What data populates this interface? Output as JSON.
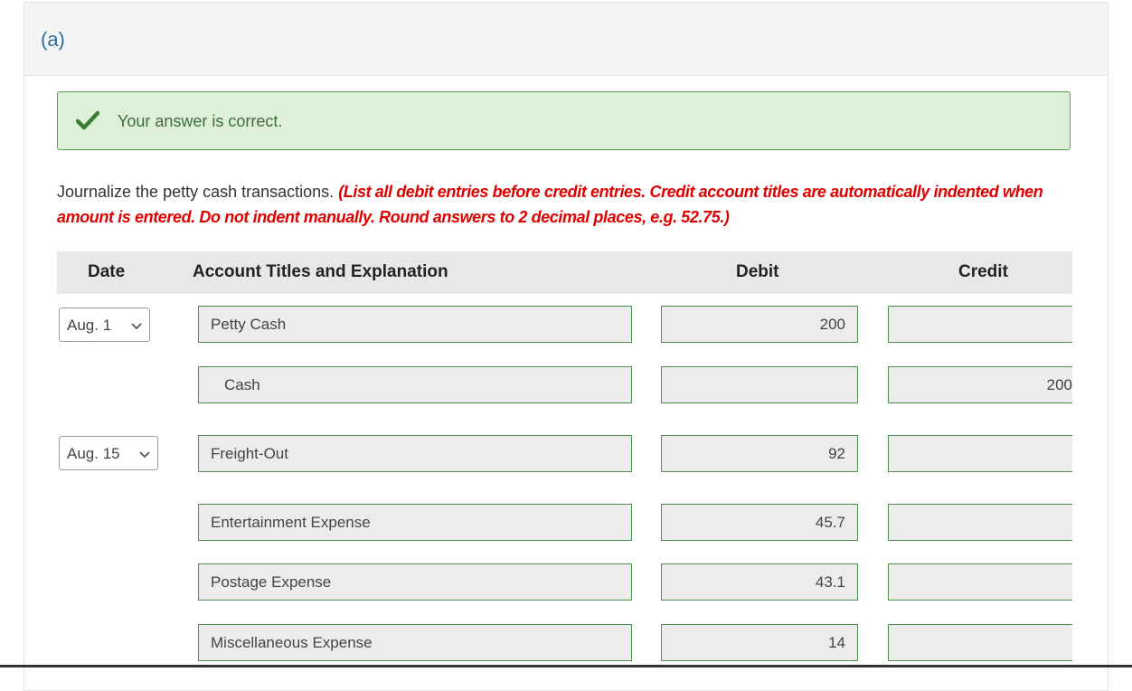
{
  "part": {
    "label": "(a)"
  },
  "feedback": {
    "message": "Your answer is correct.",
    "color": "#dff0d8"
  },
  "instructions": {
    "text": "Journalize the petty cash transactions.",
    "note": "(List all debit entries before credit entries. Credit account titles are automatically indented when amount is entered. Do not indent manually. Round answers to 2 decimal places, e.g. 52.75.)"
  },
  "table": {
    "headers": {
      "date": "Date",
      "account": "Account Titles and Explanation",
      "debit": "Debit",
      "credit": "Credit"
    },
    "rows": [
      {
        "date": "Aug. 1",
        "account": "Petty Cash",
        "debit": "200",
        "credit": ""
      },
      {
        "date": "",
        "account": "Cash",
        "debit": "",
        "credit": "200"
      },
      {
        "date": "Aug. 15",
        "account": "Freight-Out",
        "debit": "92",
        "credit": ""
      },
      {
        "date": "",
        "account": "Entertainment Expense",
        "debit": "45.7",
        "credit": ""
      },
      {
        "date": "",
        "account": "Postage Expense",
        "debit": "43.1",
        "credit": ""
      },
      {
        "date": "",
        "account": "Miscellaneous Expense",
        "debit": "14",
        "credit": ""
      }
    ]
  },
  "colors": {
    "error_note": "#e00000",
    "field_border": "#4f8f4f",
    "part_label": "#2c6e9a"
  }
}
